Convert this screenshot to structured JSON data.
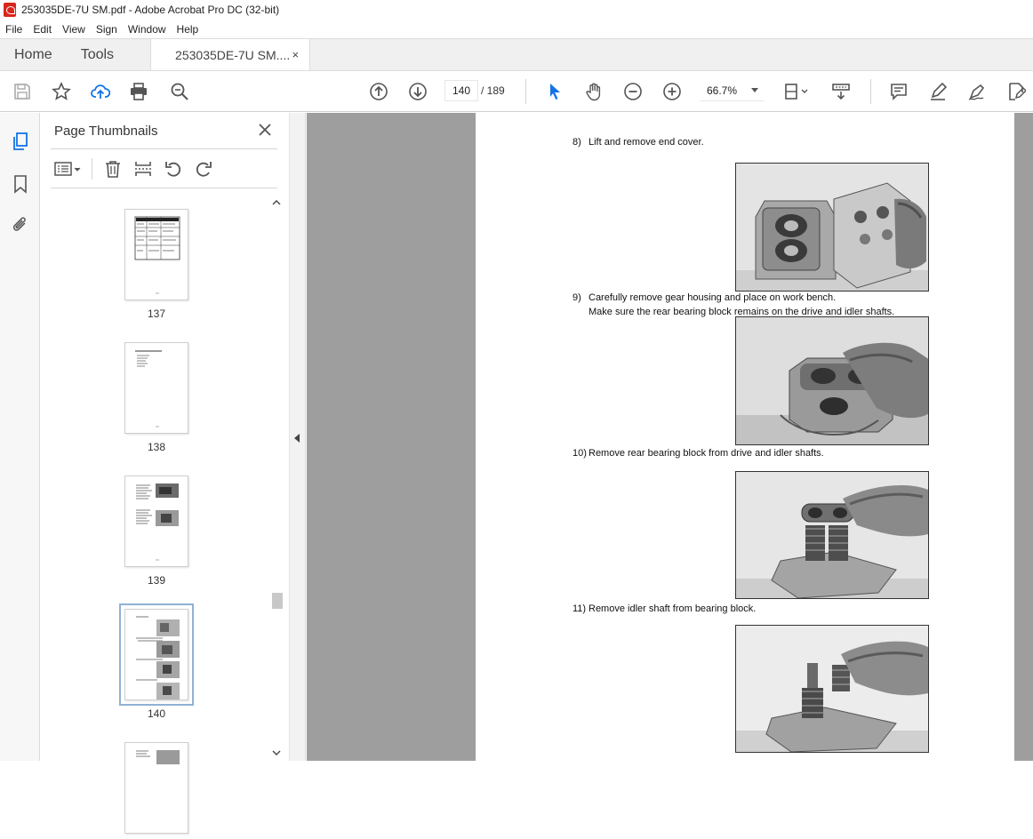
{
  "window": {
    "title": "253035DE-7U SM.pdf - Adobe Acrobat Pro DC (32-bit)"
  },
  "menu": [
    "File",
    "Edit",
    "View",
    "Sign",
    "Window",
    "Help"
  ],
  "tabs": {
    "home": "Home",
    "tools": "Tools",
    "document": "253035DE-7U SM....",
    "close": "×"
  },
  "toolbar": {
    "current_page": "140",
    "page_total": "/ 189",
    "zoom": "66.7%"
  },
  "panel": {
    "title": "Page Thumbnails",
    "thumbnails": [
      {
        "label": "137"
      },
      {
        "label": "138"
      },
      {
        "label": "139"
      },
      {
        "label": "140",
        "selected": true
      }
    ]
  },
  "document": {
    "steps": [
      {
        "num": "8)",
        "text": "Lift and remove end cover."
      },
      {
        "num": "9)",
        "text": "Carefully remove gear housing and place on work bench.",
        "text2": "Make sure the rear bearing block remains on the drive and idler shafts."
      },
      {
        "num": "10)",
        "text": "Remove rear bearing block from drive and idler shafts."
      },
      {
        "num": "11)",
        "text": "Remove idler shaft from bearing block."
      }
    ]
  },
  "colors": {
    "accent": "#1473e6",
    "selection": "#8fb2d4",
    "doc_background": "#9e9e9e",
    "pdf_red": "#d9261c"
  }
}
